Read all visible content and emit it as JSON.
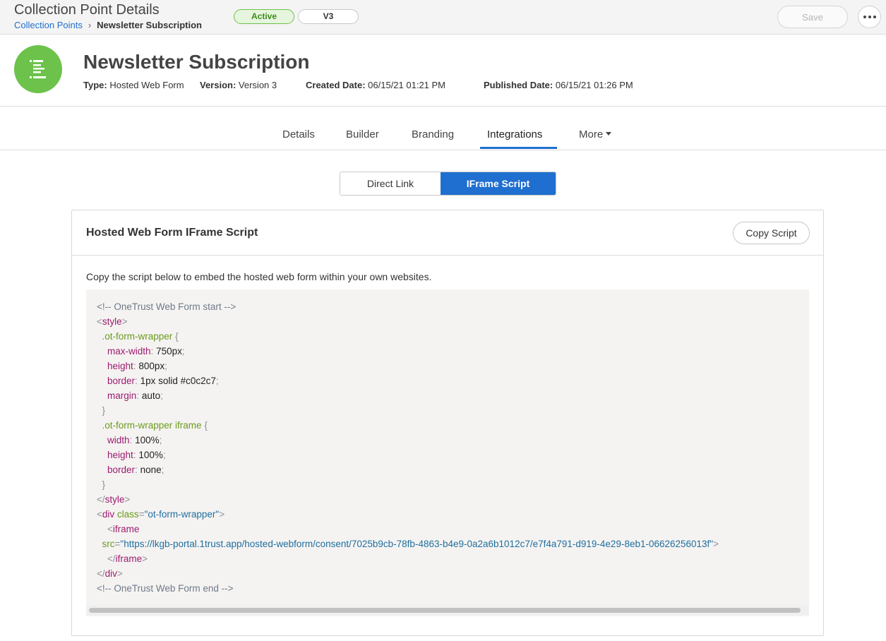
{
  "header": {
    "title": "Collection Point Details",
    "breadcrumb": {
      "parent": "Collection Points",
      "separator": "›",
      "current": "Newsletter Subscription"
    },
    "status_badge": "Active",
    "version_badge": "V3",
    "save_label": "Save"
  },
  "record": {
    "title": "Newsletter Subscription",
    "icon": "form-list-icon",
    "meta": {
      "type_label": "Type:",
      "type_value": "Hosted Web Form",
      "version_label": "Version:",
      "version_value": "Version 3",
      "created_label": "Created Date:",
      "created_value": "06/15/21 01:21 PM",
      "published_label": "Published Date:",
      "published_value": "06/15/21 01:26 PM"
    }
  },
  "tabs": [
    {
      "label": "Details"
    },
    {
      "label": "Builder"
    },
    {
      "label": "Branding"
    },
    {
      "label": "Integrations",
      "active": true
    },
    {
      "label": "More"
    }
  ],
  "segment": {
    "direct_link": "Direct Link",
    "iframe_script": "IFrame Script",
    "selected": "IFrame Script"
  },
  "card": {
    "title": "Hosted Web Form IFrame Script",
    "copy_label": "Copy Script",
    "description": "Copy the script below to embed the hosted web form within your own websites.",
    "code": {
      "comment_start": "<!-- OneTrust Web Form start -->",
      "style_tag": "style",
      "selector1": ".ot-form-wrapper",
      "max_width_prop": "max-width",
      "max_width_val": "750px",
      "height_prop": "height",
      "height_val": "800px",
      "border_prop": "border",
      "border_val": "1px solid #c0c2c7",
      "margin_prop": "margin",
      "margin_val": "auto",
      "selector2": ".ot-form-wrapper iframe",
      "width_prop": "width",
      "width_val": "100%",
      "height2_prop": "height",
      "height2_val": "100%",
      "border2_prop": "border",
      "border2_val": "none",
      "div_tag": "div",
      "class_attr": "class",
      "class_val": "\"ot-form-wrapper\"",
      "iframe_tag": "iframe",
      "src_attr": "src",
      "src_val": "\"https://lkgb-portal.1trust.app/hosted-webform/consent/7025b9cb-78fb-4863-b4e9-0a2a6b1012c7/e7f4a791-d919-4e29-8eb1-06626256013f\"",
      "comment_end": "<!-- OneTrust Web Form end -->"
    }
  },
  "colors": {
    "accent": "#1f6fd0",
    "success": "#6cc24a",
    "code_bg": "#f5f3f1"
  }
}
